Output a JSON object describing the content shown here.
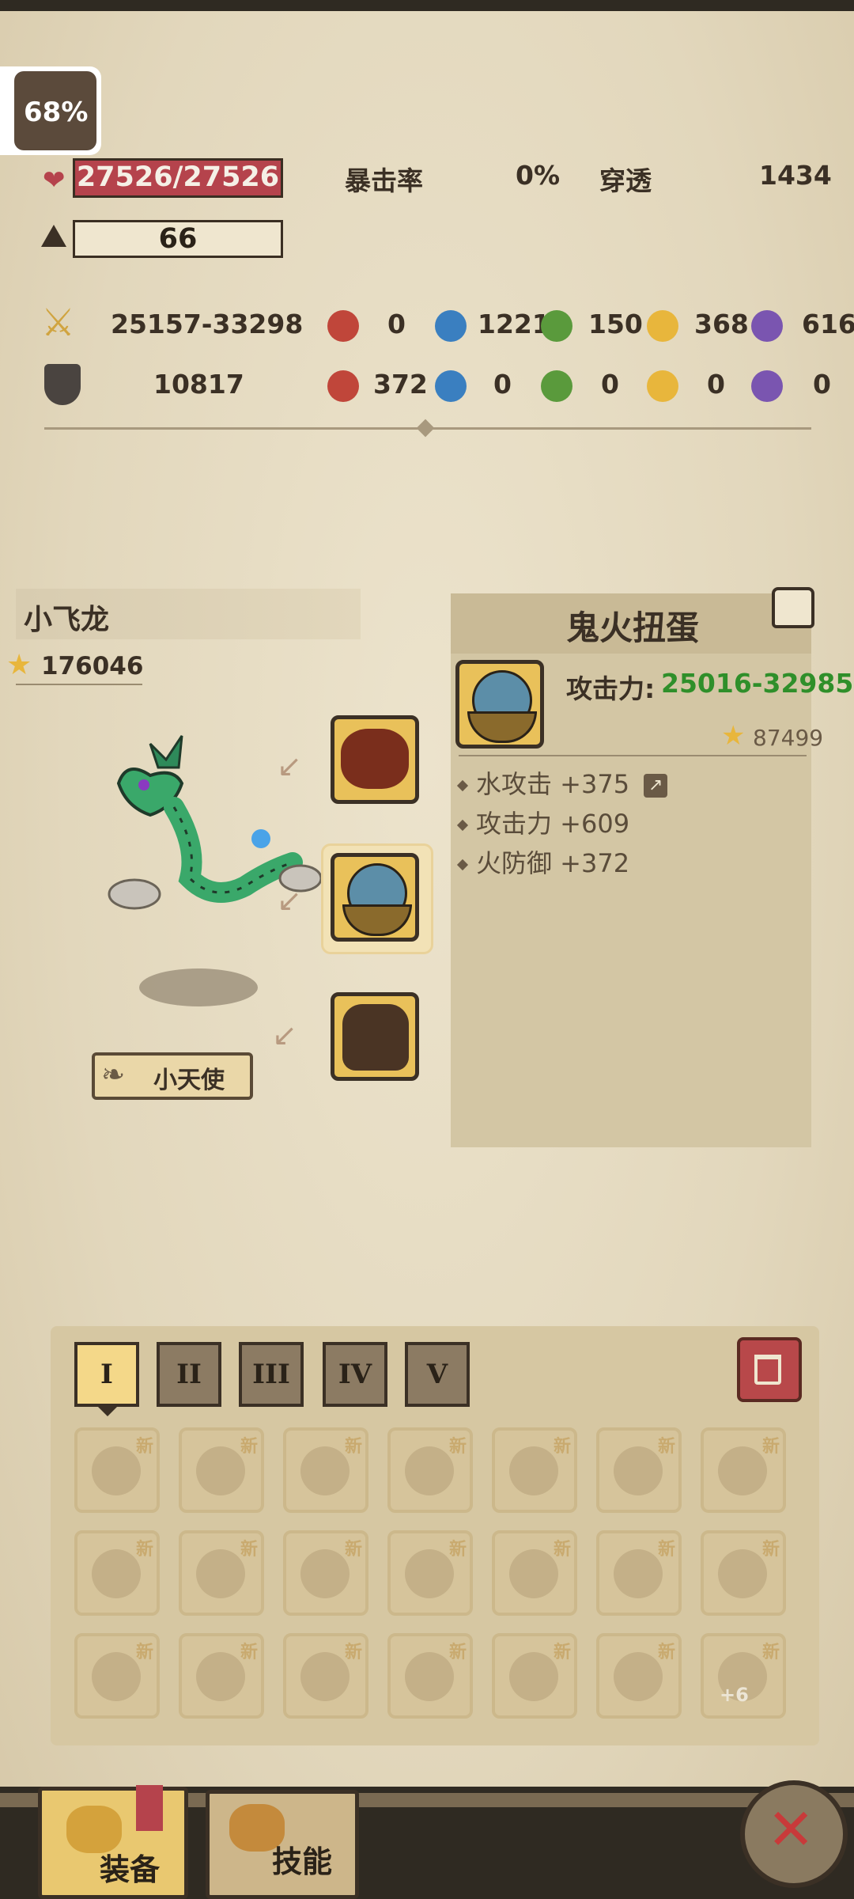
{
  "status": {
    "battery": "68%"
  },
  "stats": {
    "hp": "27526/27526",
    "level": "66",
    "crit_label": "暴击率",
    "crit_value": "0%",
    "pen_label": "穿透",
    "pen_value": "1434",
    "attack": "25157-33298",
    "defense": "10817",
    "atk_elements": [
      "0",
      "1221",
      "150",
      "368",
      "616"
    ],
    "def_elements": [
      "372",
      "0",
      "0",
      "0",
      "0"
    ]
  },
  "pet": {
    "name": "小飞龙",
    "score": "176046",
    "title_badge": "小天使"
  },
  "item_panel": {
    "name": "鬼火扭蛋",
    "attack_label": "攻击力:",
    "attack_value": "25016-32985",
    "score": "87499",
    "attributes": [
      "水攻击 +375",
      "攻击力 +609",
      "火防御 +372"
    ]
  },
  "bag": {
    "tabs": [
      "I",
      "II",
      "III",
      "IV",
      "V"
    ],
    "new_label": "新",
    "slot_badge": "+6"
  },
  "bottom_nav": {
    "equip": "装备",
    "skill": "技能"
  },
  "colors": {
    "accent_green": "#2f8f2a",
    "hp_bar": "#b5434c",
    "gold": "#e9c15a"
  }
}
